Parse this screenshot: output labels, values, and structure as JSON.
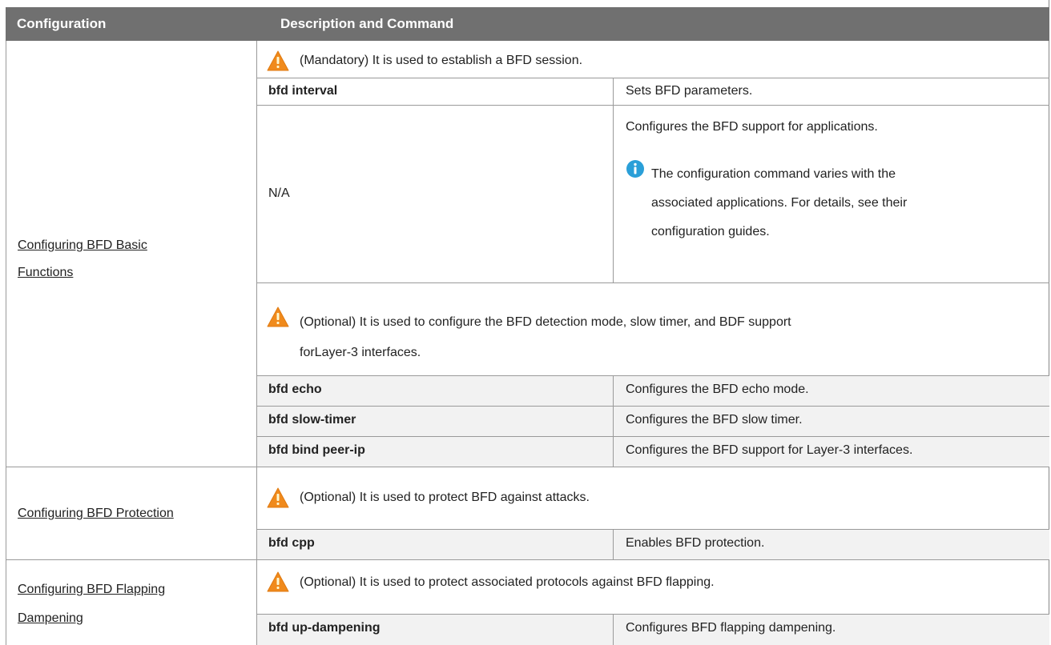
{
  "table": {
    "headers": [
      "Configuration",
      "Description and Command"
    ],
    "sections": [
      {
        "configuration": [
          "Configuring BFD Basic ",
          "Functions"
        ],
        "groups": [
          {
            "note_icon": "warning-icon",
            "note": "(Mandatory) It is used to establish a BFD session.",
            "commands": [
              {
                "command": "bfd interval",
                "description": "Sets BFD parameters."
              },
              {
                "command": "N/A",
                "description": "Configures the BFD support for applications.",
                "info_icon": "info-icon",
                "info": [
                  "The configuration command varies with the",
                  "associated applications. For details, see their",
                  "configuration guides."
                ]
              }
            ]
          },
          {
            "note_icon": "warning-icon",
            "note": [
              "(Optional) It is used to configure the BFD detection mode, slow timer, and BDF support",
              "forLayer-3 interfaces."
            ],
            "commands": [
              {
                "command": "bfd echo",
                "description": "Configures the BFD echo mode."
              },
              {
                "command": "bfd slow-timer",
                "description": "Configures the BFD slow timer."
              },
              {
                "command": "bfd bind peer-ip",
                "description": "Configures the BFD support for Layer-3 interfaces."
              }
            ]
          }
        ]
      },
      {
        "configuration": [
          "Configuring BFD Protection"
        ],
        "groups": [
          {
            "note_icon": "warning-icon",
            "note": "(Optional) It is used to protect BFD against attacks.",
            "commands": [
              {
                "command": "bfd cpp",
                "description": "Enables BFD protection."
              }
            ]
          }
        ]
      },
      {
        "configuration": [
          "Configuring BFD Flapping ",
          "Dampening"
        ],
        "groups": [
          {
            "note_icon": "warning-icon",
            "note": "(Optional) It is used to protect associated protocols against BFD flapping.",
            "commands": [
              {
                "command": "bfd up-dampening",
                "description": "Configures BFD flapping dampening."
              }
            ]
          }
        ]
      }
    ]
  },
  "colors": {
    "header_bg": "#707070",
    "header_text": "#ffffff",
    "grid_line": "#9a9a9a",
    "shaded_cell": "#f2f2f2",
    "warning": "#f08a1c",
    "info": "#2a9fd8"
  }
}
